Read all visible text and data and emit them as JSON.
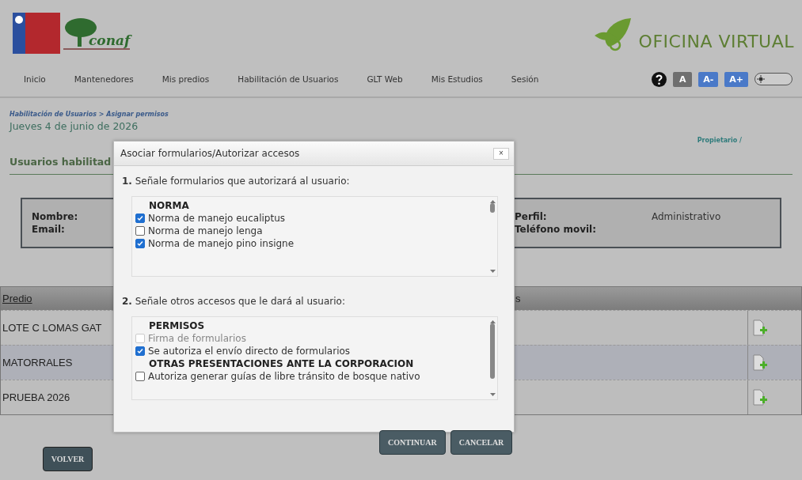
{
  "header": {
    "brand_logo_text": "conaf",
    "portal_title": "OFICINA VIRTUAL"
  },
  "nav": [
    {
      "label": "Inicio"
    },
    {
      "label": "Mantenedores"
    },
    {
      "label": "Mis predios"
    },
    {
      "label": "Habilitación de Usuarios"
    },
    {
      "label": "GLT Web"
    },
    {
      "label": "Mis Estudios"
    },
    {
      "label": "Sesión"
    }
  ],
  "font_buttons": [
    {
      "label": "A",
      "kind": "reset"
    },
    {
      "label": "A-",
      "kind": "decrease"
    },
    {
      "label": "A+",
      "kind": "increase"
    }
  ],
  "dark_mode_toggle": {
    "on": false
  },
  "breadcrumb": {
    "parent": "Habilitación de Usuarios",
    "separator": ">",
    "current": "Asignar permisos"
  },
  "date": "Jueves 4 de junio de 2026",
  "role": "Propietario /",
  "section_title": "Usuarios habilitad",
  "user_info": {
    "name_label": "Nombre:",
    "email_label": "Email:",
    "profile_label": "Perfil:",
    "profile_value": "Administrativo",
    "phone_label": "Teléfono movil:"
  },
  "table": {
    "columns": [
      "Predio",
      "s"
    ],
    "rows": [
      {
        "cells": [
          "LOTE C LOMAS GAT"
        ],
        "selected": false
      },
      {
        "cells": [
          "MATORRALES"
        ],
        "selected": true
      },
      {
        "cells": [
          "PRUEBA 2026"
        ],
        "selected": false
      }
    ]
  },
  "back_button": "VOLVER",
  "dialog": {
    "title": "Asociar formularios/Autorizar accesos",
    "close": "×",
    "sections": [
      {
        "prompt": "**1.** Señale formularios que autorizará al usuario:",
        "items": [
          {
            "kind": "heading",
            "label": "NORMA"
          },
          {
            "kind": "checkbox",
            "label": "Norma de manejo eucaliptus",
            "checked": true,
            "disabled": false
          },
          {
            "kind": "checkbox",
            "label": "Norma de manejo lenga",
            "checked": false,
            "disabled": false
          },
          {
            "kind": "checkbox",
            "label": "Norma de manejo pino insigne",
            "checked": true,
            "disabled": false
          }
        ]
      },
      {
        "prompt": "**2.** Señale otros accesos que le dará al usuario:",
        "items": [
          {
            "kind": "heading",
            "label": "PERMISOS"
          },
          {
            "kind": "checkbox",
            "label": "Firma de formularios",
            "checked": false,
            "disabled": true
          },
          {
            "kind": "checkbox",
            "label": "Se autoriza el envío directo de formularios",
            "checked": true,
            "disabled": false
          },
          {
            "kind": "heading",
            "label": "OTRAS PRESENTACIONES ANTE LA CORPORACION"
          },
          {
            "kind": "checkbox",
            "label": "Autoriza generar guías de libre tránsito de bosque nativo",
            "checked": false,
            "disabled": false
          }
        ]
      }
    ],
    "buttons": [
      "CONTINUAR",
      "CANCELAR"
    ]
  }
}
